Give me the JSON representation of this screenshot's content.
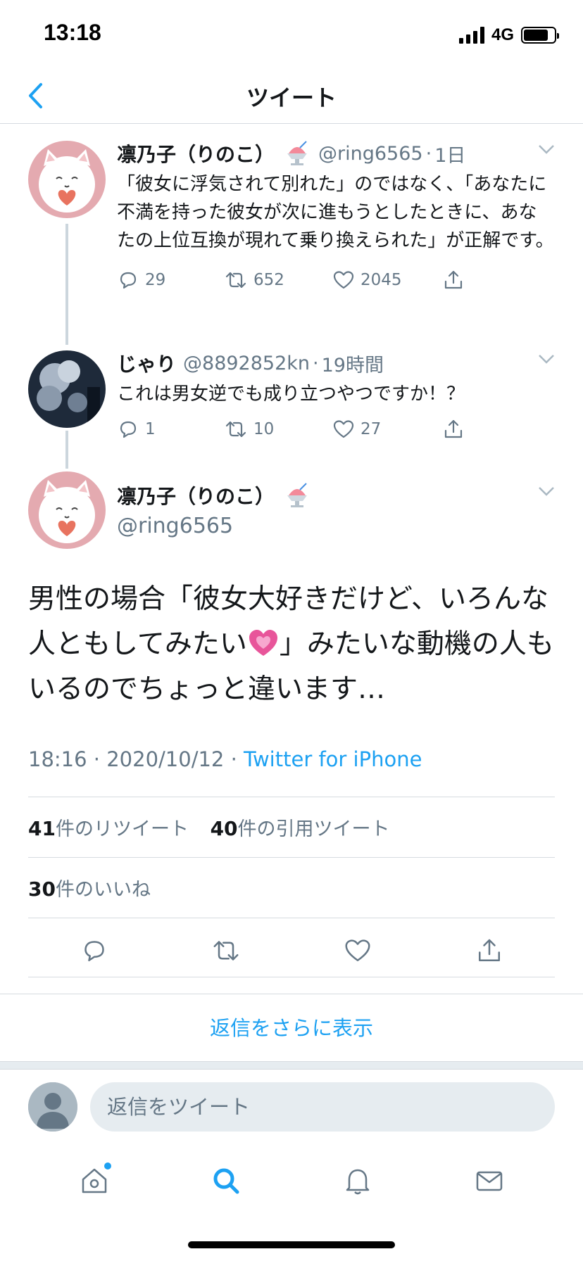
{
  "status_bar": {
    "time": "13:18",
    "network": "4G"
  },
  "header": {
    "title": "ツイート",
    "back_icon": "chevron-left-icon"
  },
  "thread": [
    {
      "display_name": "凛乃子（りのこ）",
      "handle": "@ring6565",
      "time": "1日",
      "text": "「彼女に浮気されて別れた」のではなく、「あなたに不満を持った彼女が次に進もうとしたときに、あなたの上位互換が現れて乗り換えられた」が正解です。",
      "replies": "29",
      "retweets": "652",
      "likes": "2045"
    },
    {
      "display_name": "じゃり",
      "handle": "@8892852kn",
      "time": "19時間",
      "text": "これは男女逆でも成り立つやつですか！？",
      "replies": "1",
      "retweets": "10",
      "likes": "27"
    }
  ],
  "main_tweet": {
    "display_name": "凛乃子（りのこ）",
    "handle": "@ring6565",
    "text_before_emoji": "男性の場合「彼女大好きだけど、いろんな人ともしてみたい",
    "text_after_emoji": "」みたいな動機の人もいるのでちょっと違います…",
    "time": "18:16",
    "date": "2020/10/12",
    "source": "Twitter for iPhone",
    "retweet_count": "41",
    "retweet_label": "件のリツイート",
    "quote_count": "40",
    "quote_label": "件の引用ツイート",
    "like_count": "30",
    "like_label": "件のいいね"
  },
  "more_replies_label": "返信をさらに表示",
  "reply_bar": {
    "placeholder": "返信をツイート"
  },
  "tab_bar": [
    "home-icon",
    "search-icon",
    "bell-icon",
    "mail-icon"
  ],
  "colors": {
    "accent": "#1da1f2",
    "secondary_text": "#657786",
    "divider": "#d6dbe0"
  }
}
